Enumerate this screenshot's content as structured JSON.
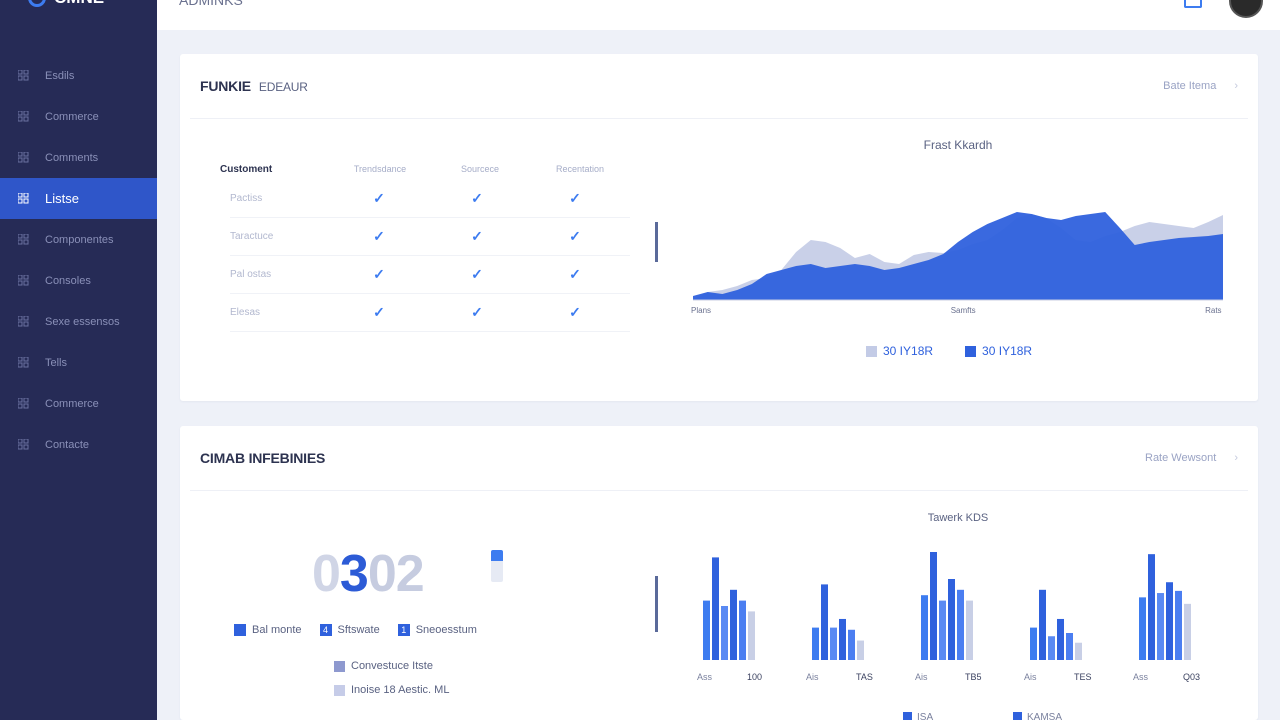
{
  "app": {
    "brand": "CMNE",
    "topbar_title": "ADMINKS"
  },
  "sidebar": {
    "items": [
      {
        "label": "Esdils",
        "active": false
      },
      {
        "label": "Commerce",
        "active": false
      },
      {
        "label": "Comments",
        "active": false
      },
      {
        "label": "Listse",
        "active": true
      },
      {
        "label": "Componentes",
        "active": false
      },
      {
        "label": "Consoles",
        "active": false
      },
      {
        "label": "Sexe essensos",
        "active": false
      },
      {
        "label": "Tells",
        "active": false
      },
      {
        "label": "Commerce",
        "active": false
      },
      {
        "label": "Contacte",
        "active": false
      }
    ]
  },
  "card1": {
    "title": "FUNKIE",
    "subtitle": "EDEAUR",
    "link": "Bate Itema",
    "table": {
      "headers": [
        "Customent",
        "Trendsdance",
        "Sourcece",
        "Recentation"
      ],
      "rows": [
        {
          "label": "Pactiss",
          "checks": [
            true,
            true,
            true
          ]
        },
        {
          "label": "Taractuce",
          "checks": [
            true,
            true,
            true
          ]
        },
        {
          "label": "Pal ostas",
          "checks": [
            true,
            true,
            true
          ]
        },
        {
          "label": "Elesas",
          "checks": [
            true,
            true,
            true
          ]
        }
      ]
    }
  },
  "card2": {
    "title": "CIMAB INFEBINIES",
    "link": "Rate Wewsont",
    "big_number": {
      "d1": "0",
      "d2": "3",
      "d3": "02"
    },
    "legend1": [
      {
        "num": "",
        "label": "Bal monte"
      },
      {
        "num": "4",
        "label": "Sftswate"
      },
      {
        "num": "1",
        "label": "Sneoesstum"
      }
    ],
    "legend2": [
      {
        "label": "Convestuce Itste"
      },
      {
        "label": "Inoise 18 Aestic. ML"
      }
    ]
  },
  "chart_data": [
    {
      "type": "area",
      "title": "Frast Kkardh",
      "x_labels": [
        "Plans",
        "Samfts",
        "Rats"
      ],
      "series": [
        {
          "name": "30",
          "color": "#c3cbe6",
          "values": [
            1,
            8,
            10,
            14,
            20,
            22,
            30,
            48,
            60,
            58,
            52,
            42,
            46,
            38,
            36,
            45,
            48,
            47,
            50,
            56,
            60,
            70,
            82,
            86,
            82,
            72,
            60,
            58,
            64,
            68,
            74,
            78,
            76,
            74,
            72,
            78,
            85
          ]
        },
        {
          "name": "30",
          "color": "#2f61dd",
          "values": [
            4,
            8,
            6,
            10,
            16,
            26,
            30,
            34,
            36,
            32,
            34,
            36,
            34,
            30,
            32,
            36,
            40,
            46,
            58,
            68,
            76,
            82,
            88,
            86,
            82,
            80,
            84,
            86,
            88,
            72,
            55,
            58,
            60,
            62,
            63,
            64,
            66
          ]
        }
      ],
      "legend": [
        {
          "label": "30 IY18R",
          "color": "#c3cbe6"
        },
        {
          "label": "30 IY18R",
          "color": "#2f61dd"
        }
      ]
    },
    {
      "type": "bar",
      "title": "Tawerk KDS",
      "categories": [
        "Ass",
        "Ais",
        "Ais",
        "Ais",
        "Ass"
      ],
      "category_totals": [
        "100",
        "TAS",
        "TB5",
        "TES",
        "Q03"
      ],
      "series_colors": [
        "#3d7cf0",
        "#2f61dd",
        "#5a8af3",
        "#2f61dd",
        "#4b7ef1",
        "#c8cfe6"
      ],
      "groups": [
        [
          55,
          95,
          50,
          65,
          55,
          45
        ],
        [
          30,
          70,
          30,
          38,
          28,
          18
        ],
        [
          60,
          100,
          55,
          75,
          65,
          55
        ],
        [
          30,
          65,
          22,
          38,
          25,
          16
        ],
        [
          58,
          98,
          62,
          72,
          64,
          52
        ]
      ],
      "legend": [
        {
          "label": "ISA",
          "color": "#2f61dd"
        },
        {
          "label": "KAMSA",
          "color": "#2f61dd"
        }
      ]
    }
  ]
}
